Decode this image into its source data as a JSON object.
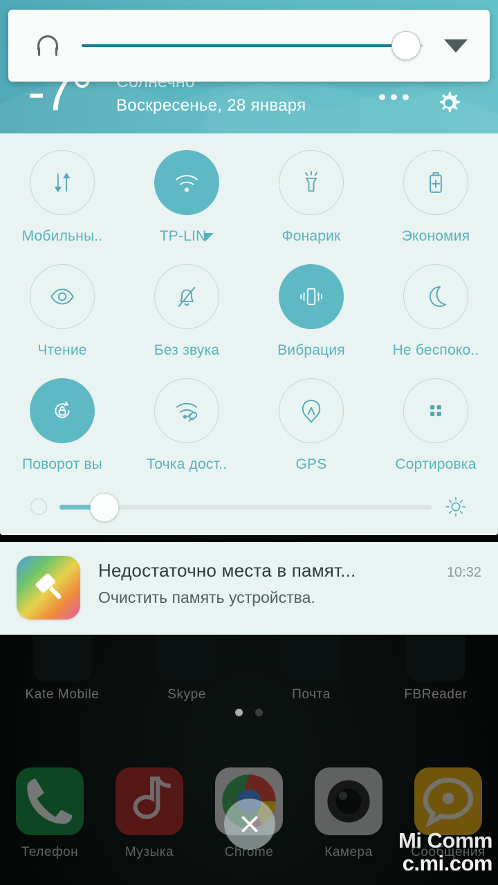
{
  "volume_dialog": {
    "icon": "headset-icon",
    "value_percent": 95,
    "expand_icon": "chevron-down-icon"
  },
  "shade_header": {
    "temperature": "-7°",
    "condition": "Солнечно",
    "date": "Воскресенье, 28 января",
    "more_icon": "overflow-dots-icon",
    "settings_icon": "gear-icon",
    "background_color": "#5cb9c3"
  },
  "quick_settings": {
    "accent_active": "#5fb9c4",
    "accent_text": "#5ab3bd",
    "panel_background": "#e9f3f1",
    "rows": [
      [
        {
          "label": "Мобильны..",
          "icon": "mobile-data-icon",
          "active": false
        },
        {
          "label": "TP-LIN",
          "icon": "wifi-icon",
          "active": true,
          "corner_triangle": true
        },
        {
          "label": "Фонарик",
          "icon": "flashlight-icon",
          "active": false
        },
        {
          "label": "Экономия",
          "icon": "battery-saver-icon",
          "active": false
        }
      ],
      [
        {
          "label": "Чтение",
          "icon": "reading-mode-eye-icon",
          "active": false
        },
        {
          "label": "Без звука",
          "icon": "bell-muted-icon",
          "active": false
        },
        {
          "label": "Вибрация",
          "icon": "vibration-icon",
          "active": true
        },
        {
          "label": "Не беспоко..",
          "icon": "moon-icon",
          "active": false
        }
      ],
      [
        {
          "label": "Поворот вы",
          "icon": "rotation-lock-icon",
          "active": true
        },
        {
          "label": "Точка дост..",
          "icon": "hotspot-icon",
          "active": false
        },
        {
          "label": "GPS",
          "icon": "gps-icon",
          "active": false
        },
        {
          "label": "Сортировка",
          "icon": "sort-grid-icon",
          "active": false
        }
      ]
    ]
  },
  "brightness": {
    "low_icon": "brightness-low-icon",
    "high_icon": "brightness-sun-icon",
    "value_percent": 12
  },
  "notification": {
    "icon": "cleaner-brush-icon",
    "title": "Недостаточно места в памят...",
    "body": "Очистить память устройства.",
    "time": "10:32"
  },
  "home_screen": {
    "app_labels": [
      "Kate Mobile",
      "Skype",
      "Почта",
      "FBReader"
    ],
    "page_dots": {
      "count": 2,
      "active_index": 0
    },
    "dock": [
      {
        "label": "Телефон",
        "icon": "phone-icon",
        "color": "#0c8a3d"
      },
      {
        "label": "Музыка",
        "icon": "music-note-icon",
        "color": "#b72a25"
      },
      {
        "label": "Chrome",
        "icon": "chrome-icon",
        "color": "#cfcfcf"
      },
      {
        "label": "Камера",
        "icon": "camera-icon",
        "color": "#b9bcbb"
      },
      {
        "label": "Сообщения",
        "icon": "chat-bubble-icon",
        "color": "#e0a400"
      }
    ],
    "close_button_icon": "close-x-icon"
  },
  "watermark": {
    "line1": "Mi Comm",
    "line2": "c.mi.com"
  }
}
